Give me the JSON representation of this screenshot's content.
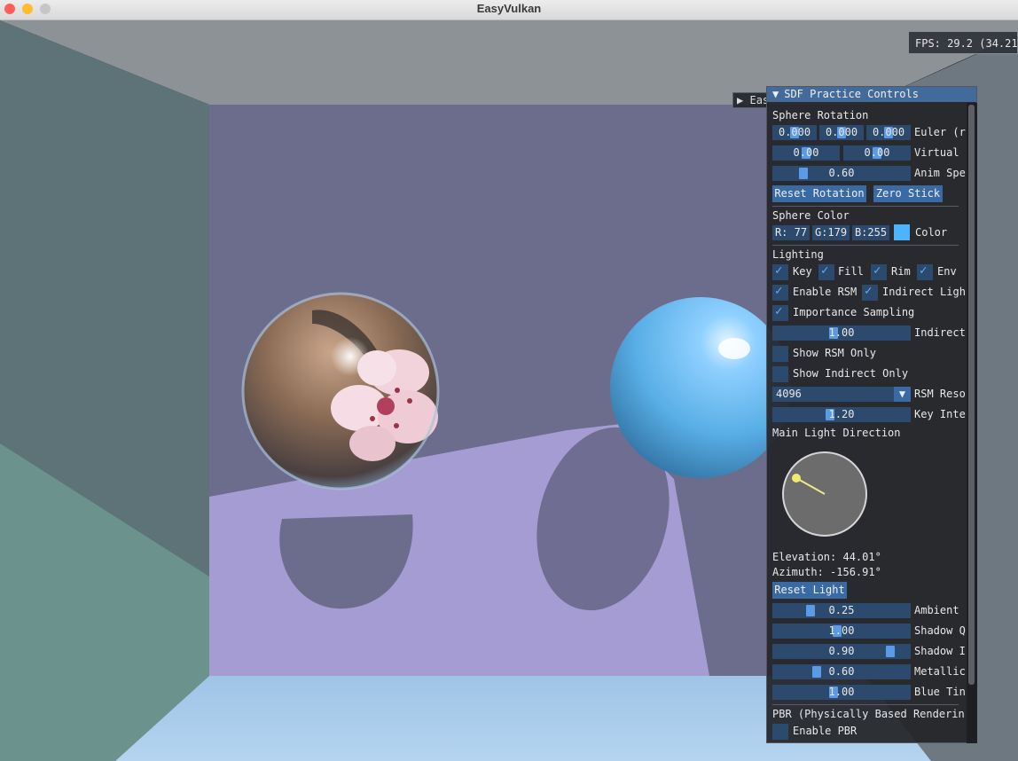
{
  "window": {
    "title": "EasyVulkan"
  },
  "overlay": {
    "fps": "FPS: 29.2 (34.21"
  },
  "collapsed_window": {
    "arrow": "▶",
    "label": "Easy"
  },
  "panel": {
    "title": "SDF Practice Controls",
    "arrow": "▼",
    "sphere_rotation": {
      "header": "Sphere Rotation",
      "euler": [
        "0.000",
        "0.000",
        "0.000"
      ],
      "euler_label": "Euler (r",
      "virtual": [
        "0.00",
        "0.00"
      ],
      "virtual_label": "Virtual",
      "anim_speed": "0.60",
      "anim_label": "Anim Spe",
      "reset_button": "Reset Rotation",
      "zero_button": "Zero Stick"
    },
    "sphere_color": {
      "header": "Sphere Color",
      "r": "R: 77",
      "g": "G:179",
      "b": "B:255",
      "label": "Color",
      "swatch": "#4db3ff"
    },
    "lighting": {
      "header": "Lighting",
      "key": "Key",
      "fill": "Fill",
      "rim": "Rim",
      "env": "Env",
      "enable_rsm": "Enable RSM",
      "indirect_light": "Indirect Ligh",
      "importance_sampling": "Importance Sampling",
      "indirect_value": "1.00",
      "indirect_label": "Indirect",
      "show_rsm_only": "Show RSM Only",
      "show_indirect_only": "Show Indirect Only",
      "rsm_resolution": "4096",
      "rsm_label": "RSM Reso",
      "key_intensity": "1.20",
      "key_label": "Key Inte",
      "main_light_direction": "Main Light Direction",
      "elevation": "Elevation: 44.01°",
      "azimuth": "Azimuth: -156.91°",
      "reset_light": "Reset Light",
      "ambient": "0.25",
      "ambient_label": "Ambient",
      "shadow_q": "1.00",
      "shadow_q_label": "Shadow Q",
      "shadow_i": "0.90",
      "shadow_i_label": "Shadow I",
      "metallic": "0.60",
      "metallic_label": "Metallic",
      "blue_tint": "1.00",
      "blue_tint_label": "Blue Tin"
    },
    "pbr": {
      "header": "PBR (Physically Based Rendering",
      "enable_pbr": "Enable PBR"
    }
  },
  "icons": {
    "checkbox": "checkmark-icon",
    "combo": "chevron-down-icon",
    "collapse": "triangle-down-icon"
  }
}
